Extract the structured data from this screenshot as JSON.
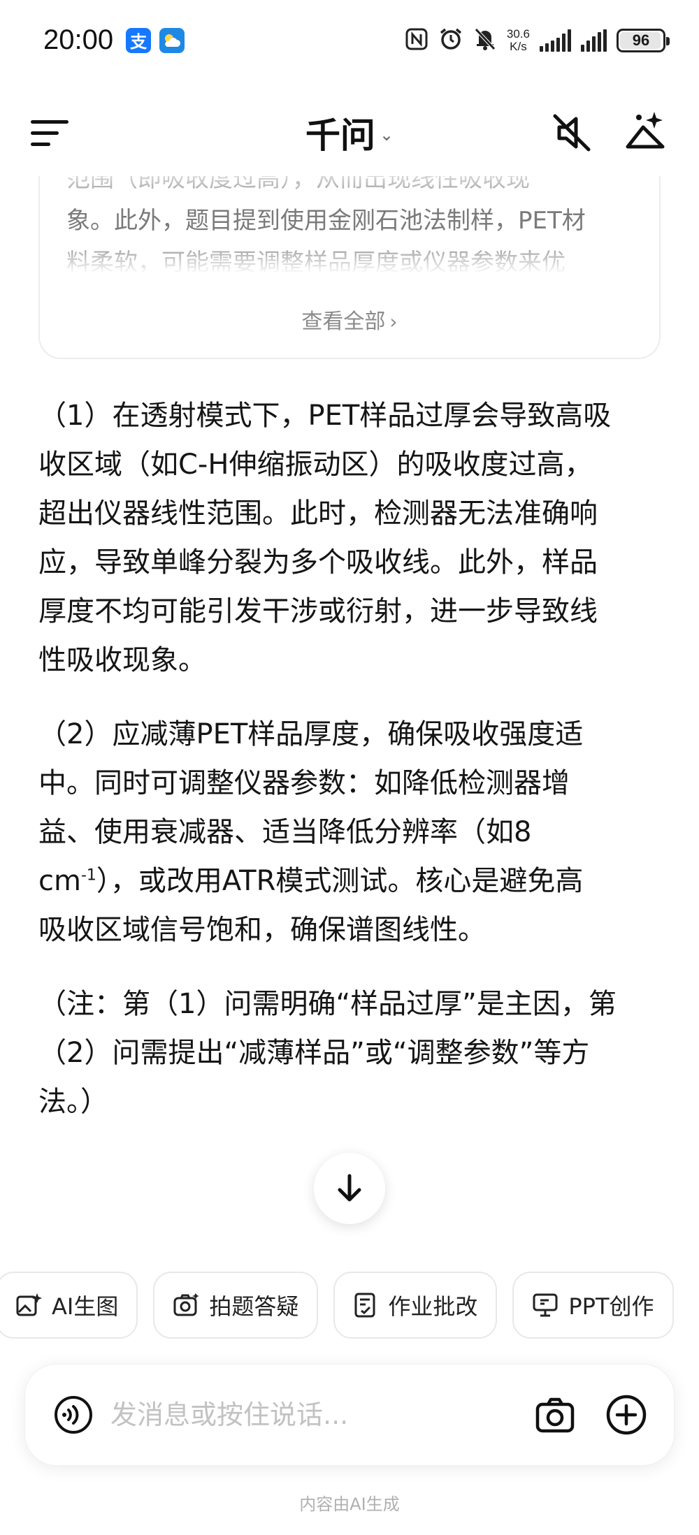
{
  "status_bar": {
    "time": "20:00",
    "alipay_glyph": "支",
    "network_speed_value": "30.6",
    "network_speed_unit": "K/s",
    "battery": "96",
    "icons": [
      "alipay-icon",
      "weather-icon",
      "nfc-icon",
      "alarm-icon",
      "mute-bell-icon",
      "signal-icon",
      "battery-icon"
    ]
  },
  "header": {
    "title": "千问",
    "title_chevron": "⌄",
    "icons": [
      "menu-icon",
      "speaker-muted-icon",
      "magic-sparkle-icon"
    ]
  },
  "thinking_card": {
    "lines": [
      "范围（即吸收度过高），从而出现线性吸收现",
      "象。此外，题目提到使用金刚石池法制样，PET材",
      "料柔软，可能需要调整样品厚度或仪器参数来优"
    ],
    "view_all": "查看全部",
    "view_all_chevron": "›"
  },
  "answer": {
    "p1": "（1）在透射模式下，PET样品过厚会导致高吸\n收区域（如C-H伸缩振动区）的吸收度过高，\n超出仪器线性范围。此时，检测器无法准确响\n应，导致单峰分裂为多个吸收线。此外，样品\n厚度不均可能引发干涉或衍射，进一步导致线\n性吸收现象。",
    "p2_before": "（2）应减薄PET样品厚度，确保吸收强度适\n中。同时可调整仪器参数：如降低检测器增\n益、使用衰减器、适当降低分辨率（如8\ncm",
    "p2_sup": "-1",
    "p2_after": "），或改用ATR模式测试。核心是避免高\n吸收区域信号饱和，确保谱图线性。",
    "p3": "（注：第（1）问需明确“样品过厚”是主因，第\n（2）问需提出“减薄样品”或“调整参数”等方\n法。）"
  },
  "chips": [
    {
      "label": "AI生图",
      "icon": "image-sparkle-icon"
    },
    {
      "label": "拍题答疑",
      "icon": "camera-question-icon"
    },
    {
      "label": "作业批改",
      "icon": "homework-check-icon"
    },
    {
      "label": "PPT创作",
      "icon": "presentation-icon"
    }
  ],
  "input": {
    "placeholder": "发消息或按住说话...",
    "icons": [
      "voice-wave-icon",
      "camera-icon",
      "plus-circle-icon"
    ]
  },
  "footer": {
    "note": "内容由AI生成"
  }
}
